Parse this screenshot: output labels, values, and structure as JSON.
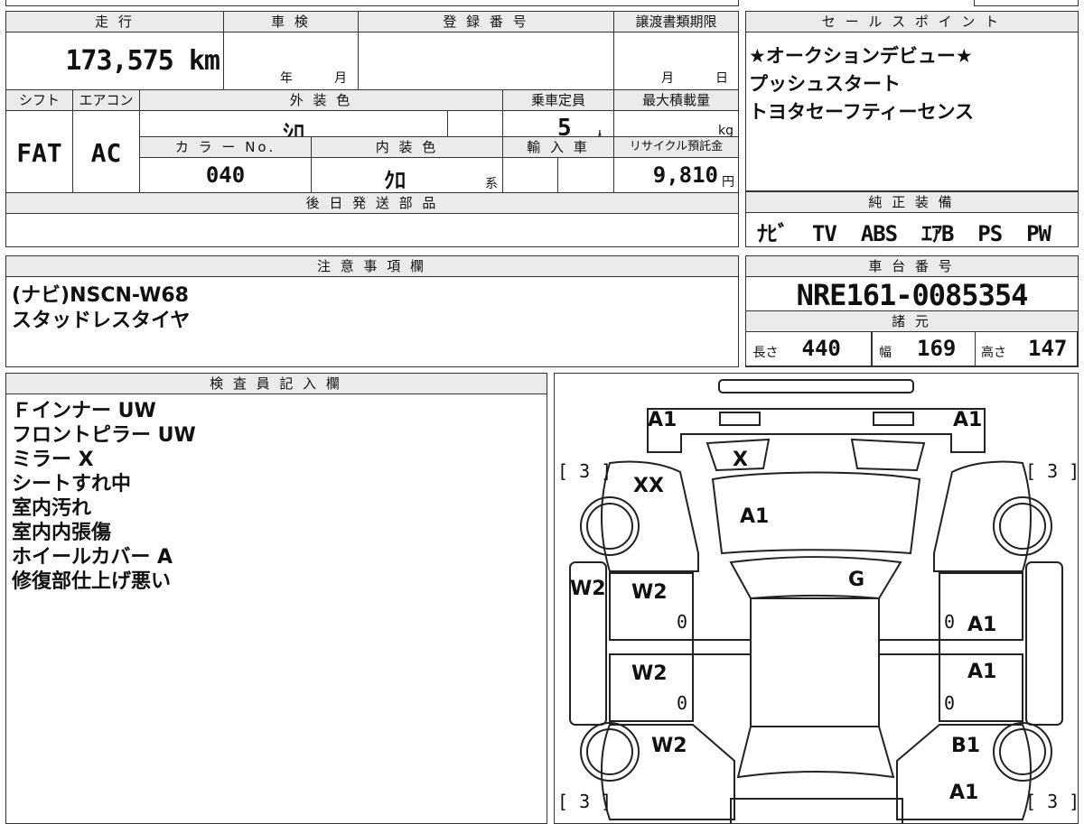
{
  "basic": {
    "mileage_label": "走 行",
    "mileage_value": "173,575 km",
    "shaken_label": "車 検",
    "shaken_year": "年",
    "shaken_month": "月",
    "reg_label": "登 録 番 号",
    "deadline_label": "譲渡書類期限",
    "deadline_month": "月",
    "deadline_day": "日",
    "shift_label": "シフト",
    "shift_value": "FAT",
    "ac_label": "エアコン",
    "ac_value": "AC",
    "exterior_label": "外 装 色",
    "exterior_value": "ｼﾛ",
    "capacity_label": "乗車定員",
    "capacity_value": "5",
    "capacity_unit": "人",
    "maxload_label": "最大積載量",
    "maxload_unit": "kg",
    "colorno_label": "カ ラ ー No.",
    "colorno_value": "040",
    "interior_label": "内 装 色",
    "interior_value": "ｸﾛ",
    "interior_unit": "系",
    "import_label": "輸 入 車",
    "recycle_label": "リサイクル預託金",
    "recycle_value": "9,810",
    "recycle_unit": "円",
    "later_parts_label": "後 日 発 送 部 品"
  },
  "sales": {
    "label": "セ ー ル ス ポ イ ン ト",
    "lines": [
      "★オークションデビュー★",
      "プッシュスタート",
      "トヨタセーフティーセンス"
    ]
  },
  "equipment": {
    "label": "純 正 装 備",
    "value": "ﾅﾋﾞ  TV  ABS  ｴｱB  PS  PW"
  },
  "notes": {
    "label": "注 意 事 項 欄",
    "lines": [
      "(ナビ)NSCN-W68",
      "スタッドレスタイヤ"
    ]
  },
  "chassis": {
    "label": "車 台 番 号",
    "value": "NRE161-0085354"
  },
  "specs": {
    "label": "諸 元",
    "length_label": "長さ",
    "length_value": "440",
    "width_label": "幅",
    "width_value": "169",
    "height_label": "高さ",
    "height_value": "147"
  },
  "inspector": {
    "label": "検 査 員 記 入 欄",
    "lines": [
      "Ｆインナー UW",
      "フロントピラー UW",
      "ミラー X",
      "シートすれ中",
      "室内汚れ",
      "室内内張傷",
      "ホイールカバー A",
      "修復部仕上げ悪い"
    ]
  },
  "diagram": {
    "marks": {
      "front_left": "A1",
      "front_right": "A1",
      "windshield_top": "X",
      "left_fender": "XX",
      "hood": "A1",
      "roof": "G",
      "left_pillar": "W2",
      "left_front_door": "W2",
      "left_front_door_zero": "0",
      "left_rear_door": "W2",
      "left_rear_door_zero": "0",
      "left_quarter": "W2",
      "right_front_door": "A1",
      "right_front_door_zero": "0",
      "right_rear_door": "A1",
      "right_rear_door_zero": "0",
      "right_quarter": "B1",
      "rear_right": "A1"
    },
    "tire_tl": "[ 3 ]",
    "tire_tr": "[ 3 ]",
    "tire_bl": "[ 3 ]",
    "tire_br": "[ 3 ]"
  }
}
